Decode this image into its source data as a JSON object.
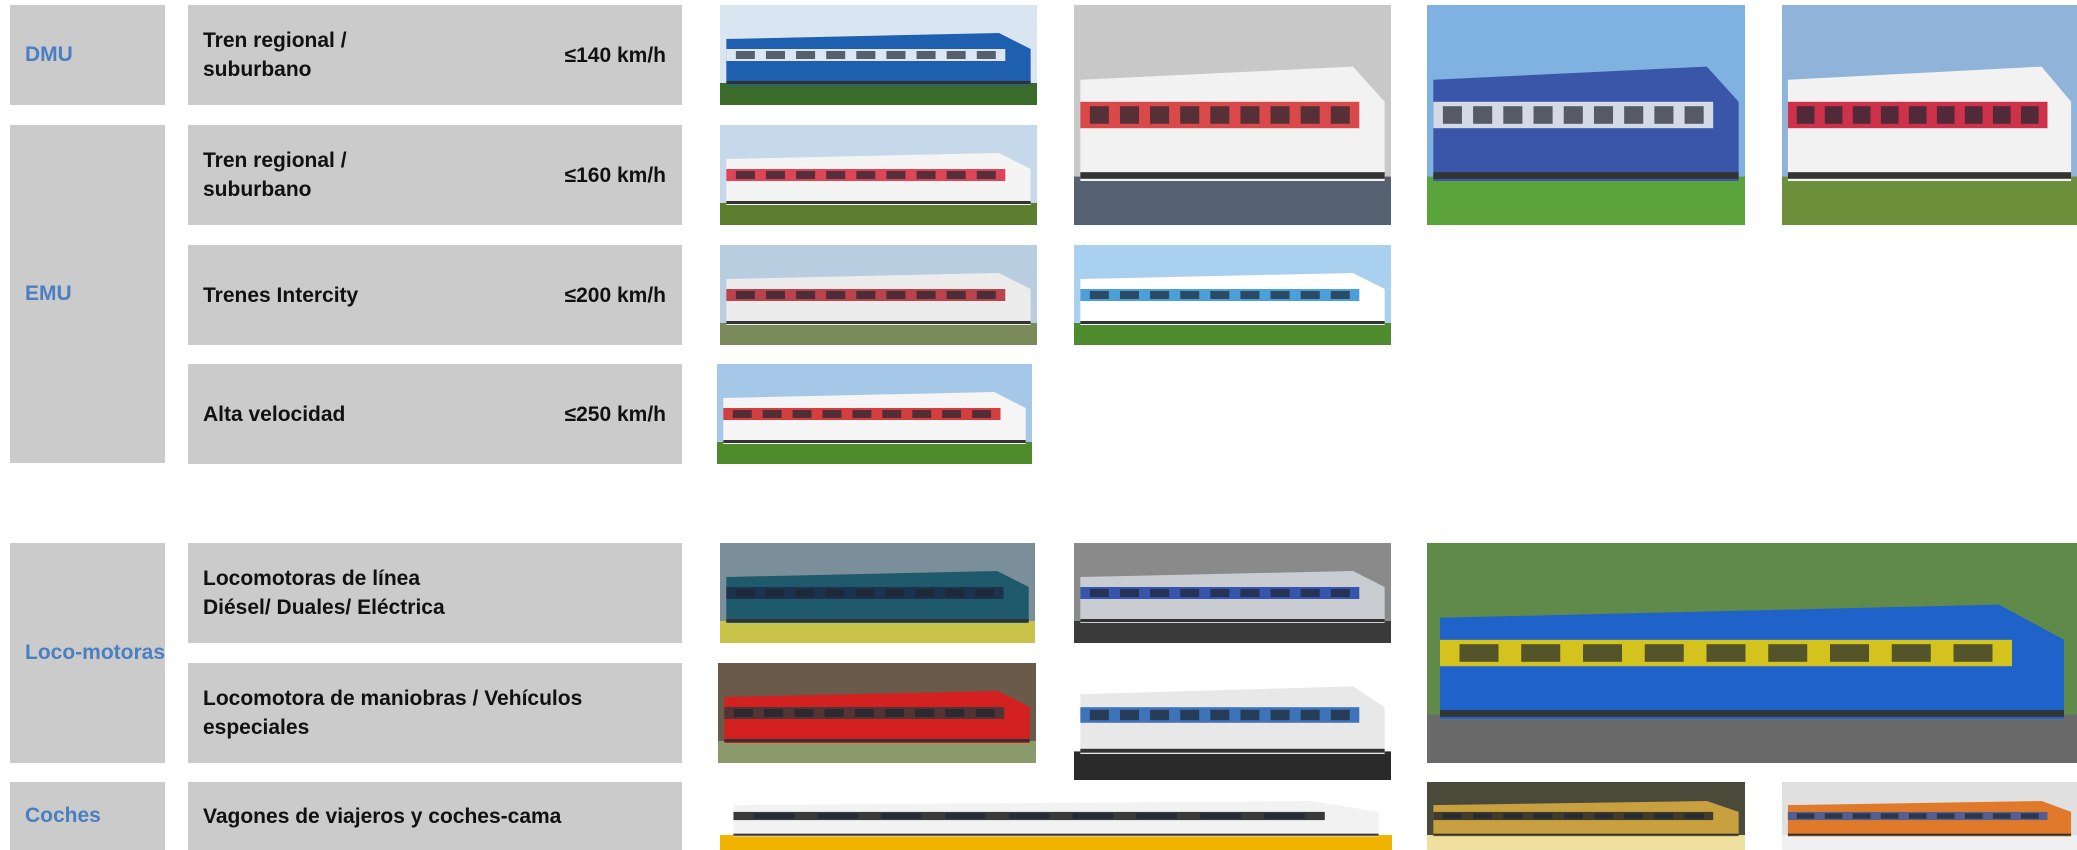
{
  "categories": {
    "dmu": "DMU",
    "emu": "EMU",
    "loco": "Loco-motoras",
    "coches": "Coches"
  },
  "rows": [
    {
      "label": "Tren regional /\nsuburbano",
      "speed": "≤140 km/h"
    },
    {
      "label": "Tren regional /\nsuburbano",
      "speed": "≤160 km/h"
    },
    {
      "label": "Trenes Intercity",
      "speed": "≤200 km/h"
    },
    {
      "label": "Alta velocidad",
      "speed": "≤250 km/h"
    },
    {
      "label": "Locomotoras de línea\nDiésel/ Duales/ Eléctrica",
      "speed": ""
    },
    {
      "label": "Locomotora de maniobras / Vehículos\nespeciales",
      "speed": ""
    },
    {
      "label": "Vagones de viajeros y coches-cama",
      "speed": ""
    }
  ],
  "photos": [
    {
      "desc": "blue and white regional DMU train",
      "colors": [
        "#d9e6f2",
        "#1f5fb0",
        "#ffffff",
        "#3b6b2a"
      ]
    },
    {
      "desc": "white double-deck EMU with red front",
      "colors": [
        "#c8c8c8",
        "#f2f2f2",
        "#d62b2b",
        "#556070"
      ]
    },
    {
      "desc": "blue, white and green regional EMU",
      "colors": [
        "#7fb2e0",
        "#3a56a8",
        "#f0f0f0",
        "#5aa33a"
      ]
    },
    {
      "desc": "white and red zb regional EMU in mountains",
      "colors": [
        "#8fb3d9",
        "#f2f2f2",
        "#c8102e",
        "#6b8f3a"
      ]
    },
    {
      "desc": "white EMU with red triangle livery",
      "colors": [
        "#c5d9ea",
        "#f4f4f4",
        "#d9263a",
        "#5c7f2f"
      ]
    },
    {
      "desc": "white and red double-deck intercity train",
      "colors": [
        "#b9cde0",
        "#ececec",
        "#b3262f",
        "#7a8a5a"
      ]
    },
    {
      "desc": "white and blue double-deck intercity train",
      "colors": [
        "#a9d0ee",
        "#ffffff",
        "#2c8fd4",
        "#4d8b2e"
      ]
    },
    {
      "desc": "white and red high-speed train",
      "colors": [
        "#a6c8e8",
        "#f5f5f5",
        "#cc1f1f",
        "#4f8a2b"
      ]
    },
    {
      "desc": "teal and dark blue line locomotive",
      "colors": [
        "#7a8f9a",
        "#1e5a6b",
        "#1c2c4a",
        "#c9c34a"
      ]
    },
    {
      "desc": "grey and blue line locomotive",
      "colors": [
        "#8a8a8a",
        "#c9cdd2",
        "#1f3fa8",
        "#3a3a3a"
      ]
    },
    {
      "desc": "blue and yellow MRS electric shunting locomotive",
      "colors": [
        "#5f8a4a",
        "#1f62c9",
        "#f5d400",
        "#6a6a6a"
      ]
    },
    {
      "desc": "red shunting locomotive with freight wagons",
      "colors": [
        "#6a5a4a",
        "#d42020",
        "#3a3a3a",
        "#8a9a6a"
      ]
    },
    {
      "desc": "white and blue shunting locomotive render",
      "colors": [
        "#ffffff",
        "#e8e8e8",
        "#1f5fb0",
        "#2a2a2a"
      ]
    },
    {
      "desc": "white passenger coaches with dark windows",
      "colors": [
        "#ffffff",
        "#f2f2f2",
        "#1a1a1a",
        "#f0b400"
      ]
    },
    {
      "desc": "gold panoramic coach",
      "colors": [
        "#4a4a3a",
        "#c8a040",
        "#2a2a2a",
        "#f0e0a0"
      ]
    },
    {
      "desc": "white and orange coach with people",
      "colors": [
        "#e0e0e0",
        "#e07a2a",
        "#3a5aa0",
        "#f0f0f0"
      ]
    }
  ]
}
